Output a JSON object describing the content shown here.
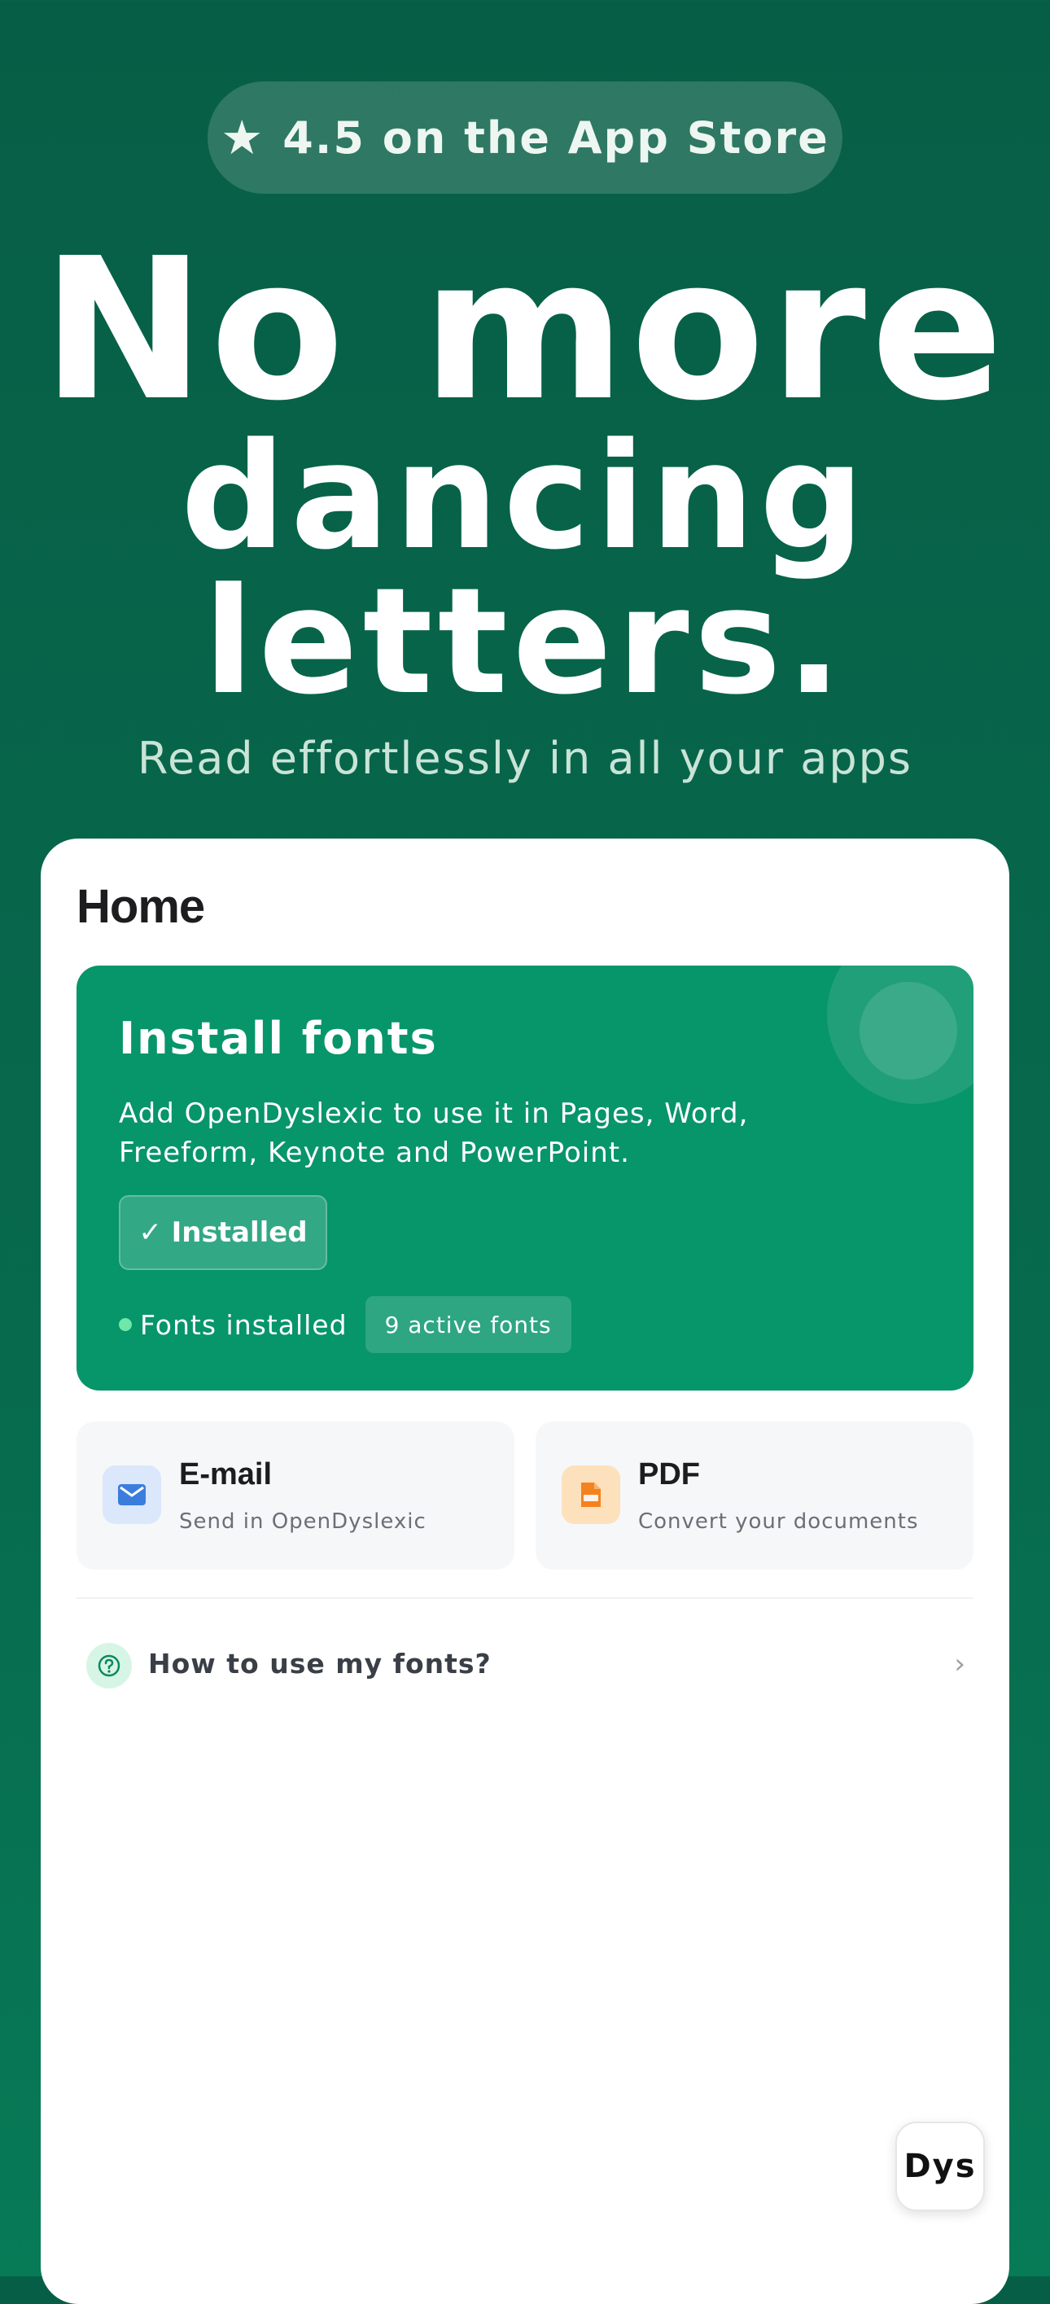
{
  "badge": {
    "star": "★",
    "text": "4.5 on the App Store"
  },
  "headline": {
    "line1": "No more",
    "line2": "dancing",
    "line3": "letters."
  },
  "subtitle": "Read effortlessly in all your apps",
  "home": {
    "title": "Home",
    "install_card": {
      "title": "Install fonts",
      "description": "Add OpenDyslexic to use it in Pages, Word, Freeform, Keynote and PowerPoint.",
      "button_label": "✓ Installed",
      "status_text": "Fonts installed",
      "active_fonts": "9 active fonts"
    },
    "tiles": [
      {
        "title": "E-mail",
        "subtitle": "Send in OpenDyslexic",
        "icon": "mail-icon"
      },
      {
        "title": "PDF",
        "subtitle": "Convert your documents",
        "icon": "pdf-icon"
      }
    ],
    "help": {
      "label": "How to use my fonts?",
      "chevron": "›"
    }
  },
  "dys_button": "Dys",
  "colors": {
    "background": "#075e46",
    "install_card": "#07956a",
    "mail_icon": "#3b7ddd",
    "pdf_icon": "#f5821f",
    "help_icon": "#0a8a5f"
  }
}
